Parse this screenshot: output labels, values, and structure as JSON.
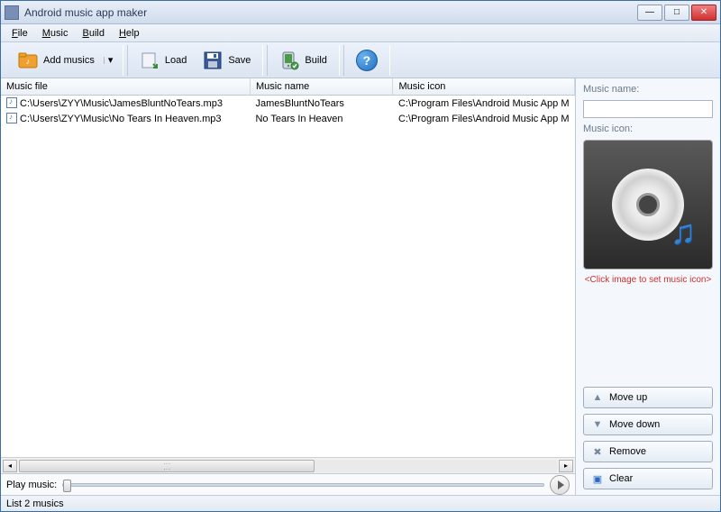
{
  "window": {
    "title": "Android music app maker"
  },
  "menu": {
    "file": "File",
    "music": "Music",
    "build": "Build",
    "help": "Help"
  },
  "toolbar": {
    "add_musics": "Add musics",
    "load": "Load",
    "save": "Save",
    "build": "Build",
    "help_symbol": "?"
  },
  "table": {
    "headers": {
      "file": "Music file",
      "name": "Music name",
      "icon": "Music icon"
    },
    "rows": [
      {
        "file": "C:\\Users\\ZYY\\Music\\JamesBluntNoTears.mp3",
        "name": "JamesBluntNoTears",
        "icon": "C:\\Program Files\\Android Music App M"
      },
      {
        "file": "C:\\Users\\ZYY\\Music\\No Tears In Heaven.mp3",
        "name": "No Tears In Heaven",
        "icon": "C:\\Program Files\\Android Music App M"
      }
    ]
  },
  "side": {
    "name_label": "Music name:",
    "name_value": "",
    "icon_label": "Music icon:",
    "icon_hint": "<Click image to set music icon>",
    "move_up": "Move up",
    "move_down": "Move down",
    "remove": "Remove",
    "clear": "Clear"
  },
  "playbar": {
    "label": "Play music:"
  },
  "status": {
    "text": "List 2 musics"
  }
}
